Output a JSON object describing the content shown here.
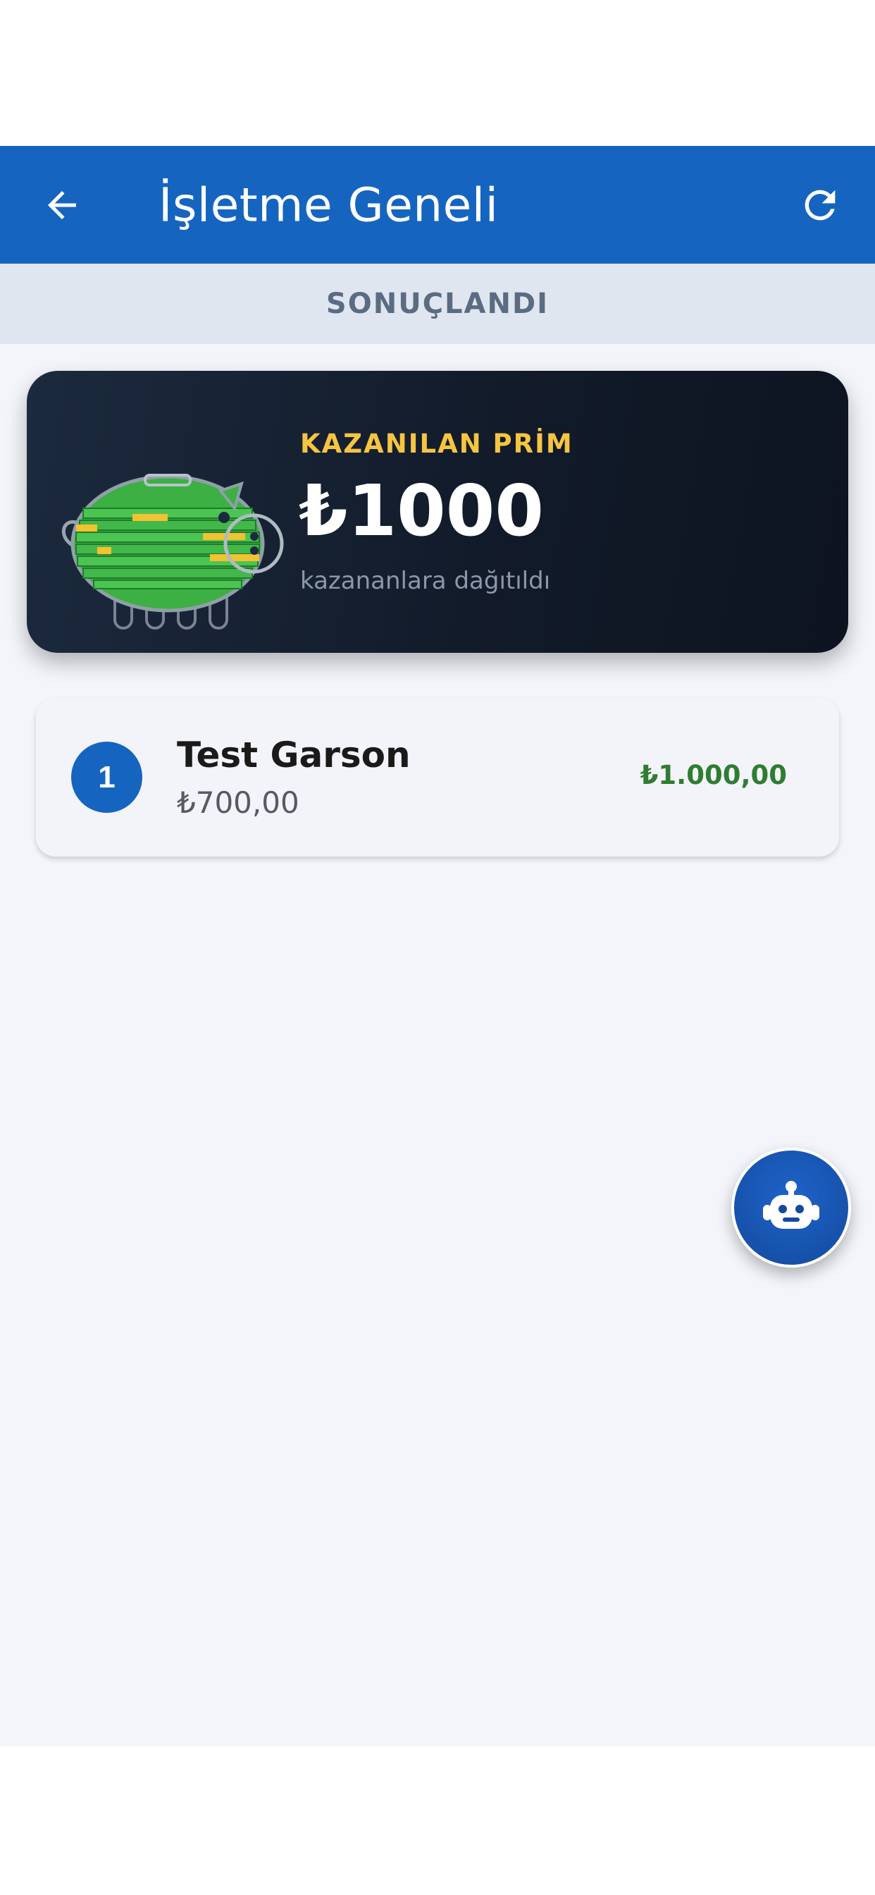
{
  "header": {
    "title": "İşletme Geneli",
    "back_icon": "arrow-left-icon",
    "refresh_icon": "refresh-icon",
    "color": "#1565c0"
  },
  "status": {
    "label": "SONUÇLANDI"
  },
  "prize_card": {
    "label": "KAZANILAN PRİM",
    "amount": "₺1000",
    "note": "kazananlara dağıtıldı",
    "icon": "piggy-bank-money-icon",
    "label_color": "#f5c542"
  },
  "winners": [
    {
      "rank": "1",
      "name": "Test Garson",
      "sales": "₺700,00",
      "prize": "₺1.000,00"
    }
  ],
  "fab": {
    "icon": "robot-icon"
  }
}
